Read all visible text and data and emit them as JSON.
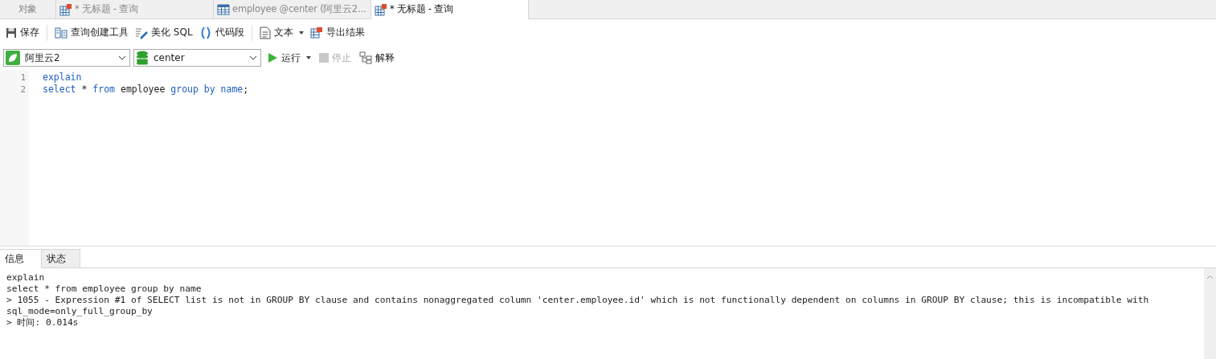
{
  "tabs": [
    {
      "label": "对象",
      "kind": "plain",
      "selected": false
    },
    {
      "label": "* 无标题 - 查询",
      "kind": "query",
      "selected": false
    },
    {
      "label": "employee @center (阿里云2...",
      "kind": "table",
      "selected": false
    },
    {
      "label": "* 无标题 - 查询",
      "kind": "query",
      "selected": true
    }
  ],
  "toolbar": [
    {
      "label": "保存",
      "kind": "save"
    },
    {
      "label": "查询创建工具",
      "kind": "builder"
    },
    {
      "label": "美化 SQL",
      "kind": "beautify"
    },
    {
      "label": "代码段",
      "kind": "snippet"
    },
    {
      "label": "文本",
      "kind": "text"
    },
    {
      "label": "导出结果",
      "kind": "export"
    }
  ],
  "connection": {
    "value": "阿里云2"
  },
  "database": {
    "value": "center"
  },
  "actions": [
    {
      "label": "运行",
      "kind": "run",
      "disabled": false
    },
    {
      "label": "停止",
      "kind": "stop",
      "disabled": true
    },
    {
      "label": "解释",
      "kind": "explain",
      "disabled": false
    }
  ],
  "editor": {
    "lines": [
      {
        "number": "1",
        "tokens": [
          {
            "text": "explain",
            "kind": "keyword"
          }
        ]
      },
      {
        "number": "2",
        "tokens": [
          {
            "text": "select",
            "kind": "keyword"
          },
          {
            "text": " * ",
            "kind": "plain"
          },
          {
            "text": "from",
            "kind": "keyword"
          },
          {
            "text": " employee ",
            "kind": "plain"
          },
          {
            "text": "group by name",
            "kind": "keyword"
          },
          {
            "text": ";",
            "kind": "plain"
          }
        ]
      }
    ]
  },
  "result_tabs": [
    {
      "label": "信息",
      "selected": true
    },
    {
      "label": "状态",
      "selected": false
    }
  ],
  "output": [
    "explain",
    "select * from employee group by name",
    "> 1055 - Expression #1 of SELECT list is not in GROUP BY clause and contains nonaggregated column 'center.employee.id' which is not functionally dependent on columns in GROUP BY clause; this is incompatible with",
    "sql_mode=only_full_group_by",
    "> 时间: 0.014s"
  ]
}
